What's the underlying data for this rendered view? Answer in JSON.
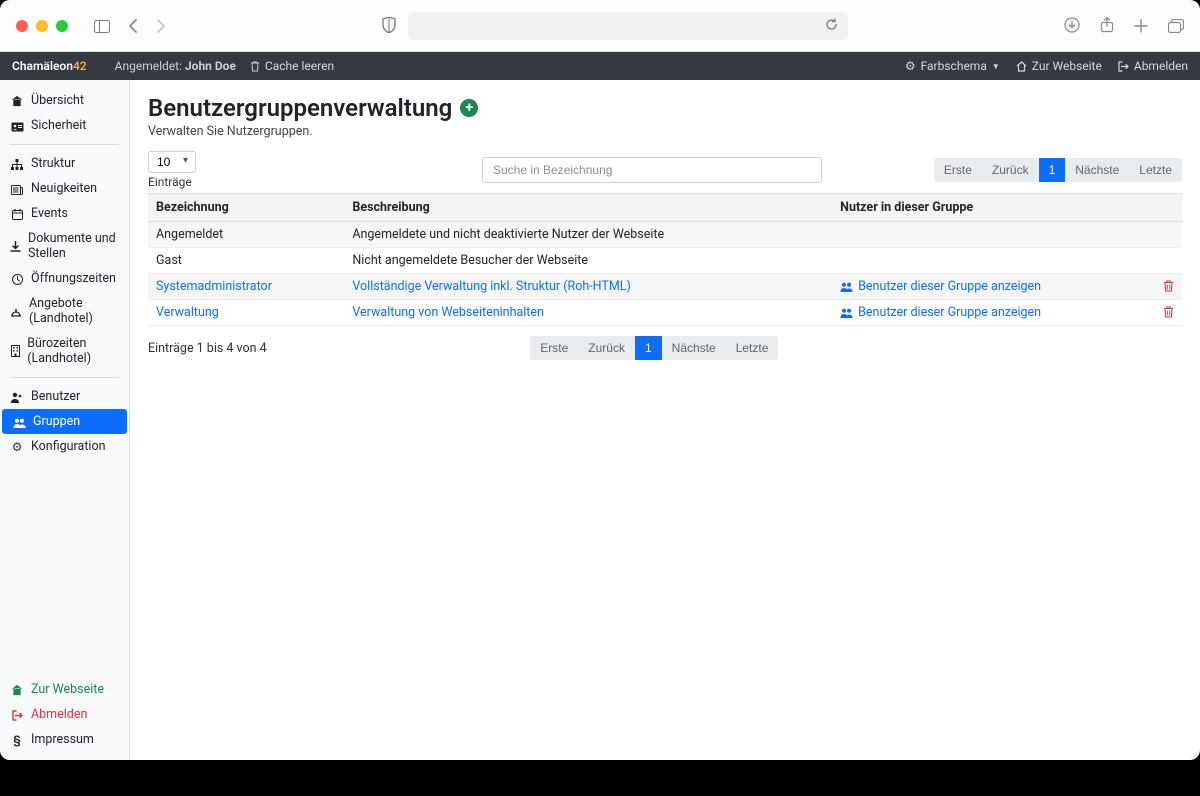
{
  "browser": {
    "tabs_icon": "⧉",
    "back": "‹",
    "forward": "›",
    "refresh": "↻"
  },
  "topbar": {
    "brand_a": "Chamäleon",
    "brand_b": "42",
    "logged_in_prefix": "Angemeldet: ",
    "user_name": "John Doe",
    "clear_cache": "Cache leeren",
    "color_scheme": "Farbschema",
    "to_website": "Zur Webseite",
    "logout": "Abmelden"
  },
  "sidebar": {
    "overview": "Übersicht",
    "security": "Sicherheit",
    "structure": "Struktur",
    "news": "Neuigkeiten",
    "events": "Events",
    "docs_jobs": "Dokumente und Stellen",
    "opening_hours": "Öffnungszeiten",
    "offers_landhotel": "Angebote (Landhotel)",
    "office_landhotel": "Bürozeiten (Landhotel)",
    "users": "Benutzer",
    "groups": "Gruppen",
    "configuration": "Konfiguration",
    "to_website": "Zur Webseite",
    "logout": "Abmelden",
    "imprint": "Impressum"
  },
  "page": {
    "title": "Benutzergruppenverwaltung",
    "subtitle": "Verwalten Sie Nutzergruppen."
  },
  "controls": {
    "page_size_value": "10",
    "entries_label": "Einträge",
    "search_placeholder": "Suche in Bezeichnung"
  },
  "pager": {
    "first": "Erste",
    "prev": "Zurück",
    "current": "1",
    "next": "Nächste",
    "last": "Letzte"
  },
  "table": {
    "col_name": "Bezeichnung",
    "col_desc": "Beschreibung",
    "col_users": "Nutzer in dieser Gruppe",
    "rows": [
      {
        "name": "Angemeldet",
        "desc": "Angemeldete und nicht deaktivierte Nutzer der Webseite",
        "link": false,
        "show_users": false
      },
      {
        "name": "Gast",
        "desc": "Nicht angemeldete Besucher der Webseite",
        "link": false,
        "show_users": false
      },
      {
        "name": "Systemadministrator",
        "desc": "Vollständige Verwaltung inkl. Struktur (Roh-HTML)",
        "link": true,
        "show_users": true
      },
      {
        "name": "Verwaltung",
        "desc": "Verwaltung von Webseiteninhalten",
        "link": true,
        "show_users": true
      }
    ],
    "show_users_label": "Benutzer dieser Gruppe anzeigen",
    "info": "Einträge 1 bis 4 von 4"
  }
}
